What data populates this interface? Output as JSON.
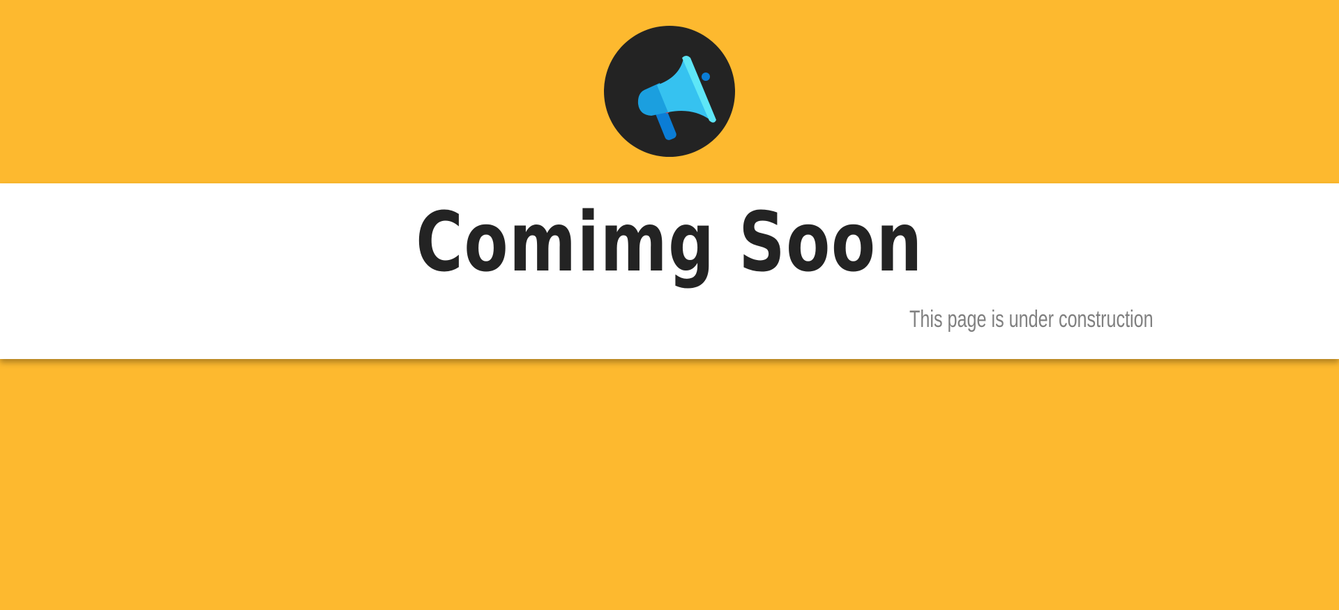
{
  "page": {
    "background_color": "#fdb92f"
  },
  "logo": {
    "icon": "megaphone-icon",
    "circle_color": "#232323",
    "icon_colors": [
      "#36c2f0",
      "#1b9fdf",
      "#0b7dd6",
      "#5ee6f7",
      "#e23b4b"
    ]
  },
  "banner": {
    "title": "Comimg Soon",
    "subtitle": "This page is under construction",
    "background_color": "#ffffff",
    "title_color": "#232323",
    "subtitle_color": "#808080"
  }
}
